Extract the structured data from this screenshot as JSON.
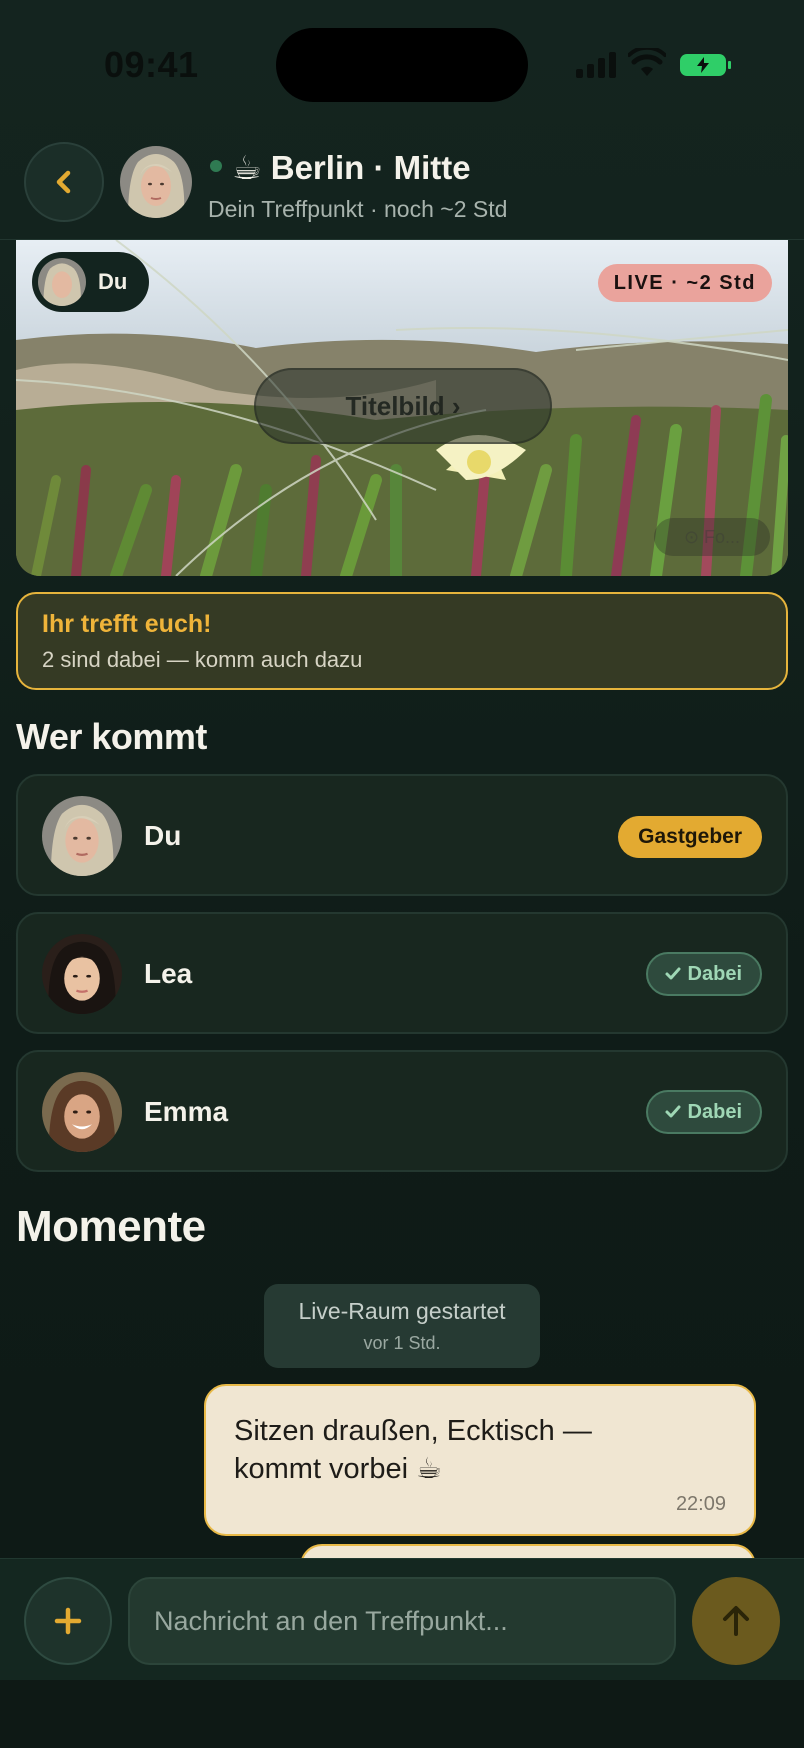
{
  "status_bar": {
    "time": "09:41"
  },
  "header": {
    "title": "☕ Berlin · Mitte",
    "subtitle": "Dein Treffpunkt · noch ~2 Std"
  },
  "hero": {
    "self_chip": "Du",
    "live_badge": "LIVE · ~2 Std",
    "cover_button": "Titelbild ›",
    "faint_chip": "⊙ Fo..."
  },
  "banner": {
    "title": "Ihr trefft euch!",
    "subtitle": "2 sind dabei — komm auch dazu"
  },
  "attendees": {
    "title": "Wer kommt",
    "people": [
      {
        "name": "Du",
        "badge": "Gastgeber"
      },
      {
        "name": "Lea",
        "badge": "Dabei"
      },
      {
        "name": "Emma",
        "badge": "Dabei"
      }
    ]
  },
  "moments": {
    "title": "Momente",
    "system_message": {
      "text": "Live-Raum gestartet",
      "time": "vor 1 Std."
    },
    "messages": [
      {
        "text": "Sitzen draußen, Ecktisch — kommt vorbei ☕",
        "time": "22:09"
      }
    ]
  },
  "composer": {
    "placeholder": "Nachricht an den Treffpunkt..."
  },
  "colors": {
    "background": "#13231e",
    "accent_gold": "#e3aa31",
    "live_badge": "#eaa39c",
    "dabei_green": "#9fd7b5",
    "bubble": "#f0e6d2"
  },
  "icons": [
    "back-chevron-icon",
    "plus-icon",
    "send-arrow-icon",
    "check-icon",
    "signal-icon",
    "wifi-icon",
    "battery-icon"
  ]
}
